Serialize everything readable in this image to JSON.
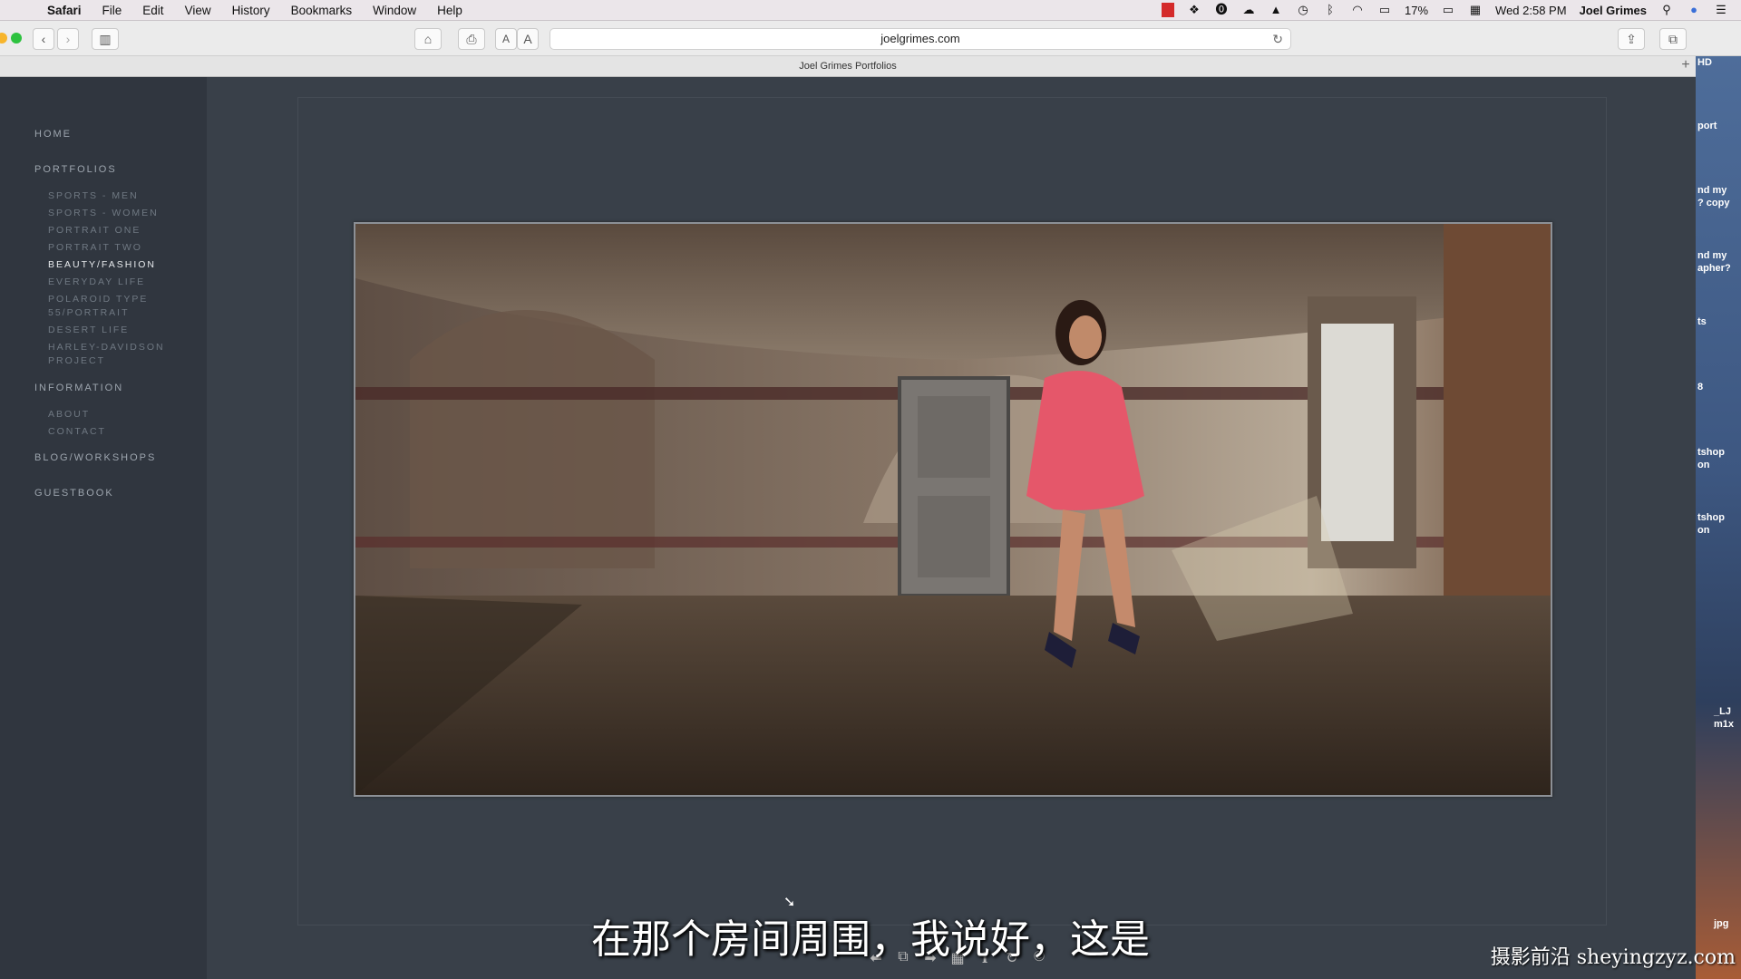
{
  "menubar": {
    "app": "Safari",
    "items": [
      "File",
      "Edit",
      "View",
      "History",
      "Bookmarks",
      "Window",
      "Help"
    ],
    "battery": "17%",
    "clock": "Wed 2:58 PM",
    "user": "Joel Grimes"
  },
  "toolbar": {
    "url": "joelgrimes.com",
    "font_small": "A",
    "font_large": "A"
  },
  "tab": {
    "title": "Joel Grimes Portfolios"
  },
  "nav": {
    "home": "HOME",
    "portfolios": "PORTFOLIOS",
    "portfolio_items": [
      "SPORTS - MEN",
      "SPORTS - WOMEN",
      "PORTRAIT ONE",
      "PORTRAIT TWO",
      "BEAUTY/FASHION",
      "EVERYDAY LIFE",
      "POLAROID TYPE 55/PORTRAIT",
      "DESERT LIFE",
      "HARLEY-DAVIDSON PROJECT"
    ],
    "active_item": "BEAUTY/FASHION",
    "information": "INFORMATION",
    "info_items": [
      "ABOUT",
      "CONTACT"
    ],
    "blog": "BLOG/WORKSHOPS",
    "guestbook": "GUESTBOOK"
  },
  "desktop_labels": [
    "HD",
    "port",
    "nd my",
    "? copy",
    "nd my",
    "apher?",
    "ts",
    "8",
    "tshop",
    "on",
    "tshop",
    "on",
    "_LJ",
    "m1x",
    "jpg"
  ],
  "subtitle": "在那个房间周围，我说好，这是",
  "watermark": "摄影前沿 sheyingzyz.com"
}
